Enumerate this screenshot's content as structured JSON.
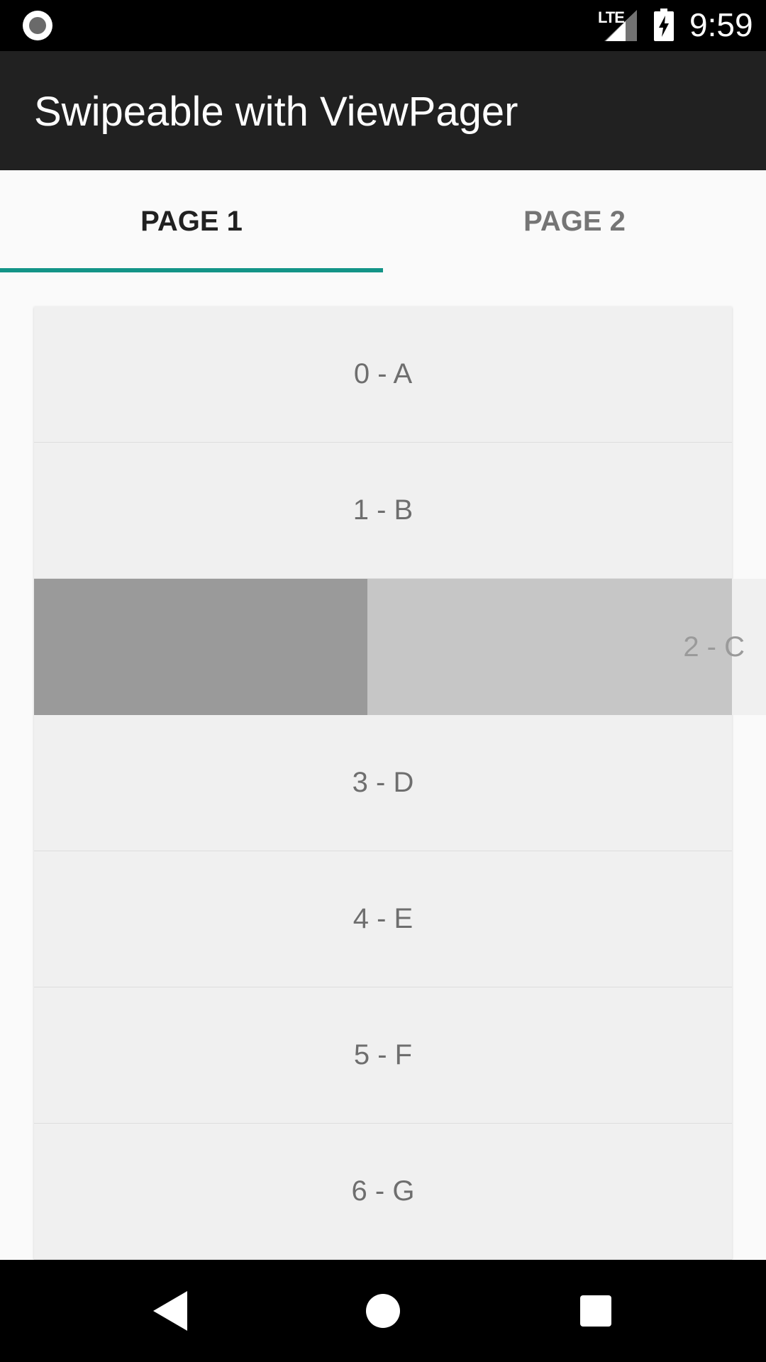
{
  "status_bar": {
    "network_label": "LTE",
    "time": "9:59",
    "icons": [
      "screen-record-icon",
      "signal-icon",
      "battery-charging-icon"
    ]
  },
  "app_bar": {
    "title": "Swipeable with ViewPager"
  },
  "tabs": [
    {
      "label": "PAGE 1",
      "selected": true
    },
    {
      "label": "PAGE 2",
      "selected": false
    }
  ],
  "list": {
    "items": [
      {
        "label": "0 - A"
      },
      {
        "label": "1 - B"
      },
      {
        "label": "2 - C",
        "state": "swiping"
      },
      {
        "label": "3 - D"
      },
      {
        "label": "4 - E"
      },
      {
        "label": "5 - F"
      },
      {
        "label": "6 - G"
      }
    ]
  },
  "nav_bar": {
    "icons": [
      "back-icon",
      "home-icon",
      "recents-icon"
    ]
  },
  "colors": {
    "status_bar": "#000000",
    "app_bar": "#212121",
    "tab_indicator": "#139487",
    "list_item_bg": "#f0f0f0",
    "swipe_background_dark": "#9a9a9a",
    "swipe_background_light": "#c6c6c6"
  }
}
